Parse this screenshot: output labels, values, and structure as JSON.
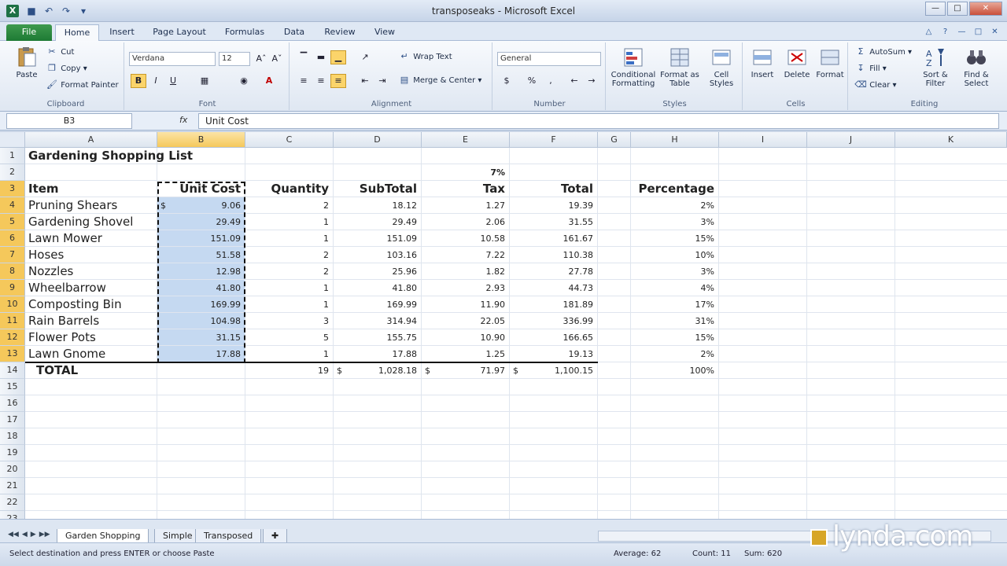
{
  "window": {
    "title": "transposeaks - Microsoft Excel"
  },
  "ribbon": {
    "tabs": [
      "File",
      "Home",
      "Insert",
      "Page Layout",
      "Formulas",
      "Data",
      "Review",
      "View"
    ],
    "active_tab": "Home",
    "clipboard": {
      "paste": "Paste",
      "cut": "Cut",
      "copy": "Copy",
      "format_painter": "Format Painter",
      "label": "Clipboard"
    },
    "font": {
      "name": "Verdana",
      "size": "12",
      "bold": "B",
      "italic": "I",
      "underline": "U",
      "label": "Font"
    },
    "alignment": {
      "wrap_text": "Wrap Text",
      "merge_center": "Merge & Center",
      "label": "Alignment"
    },
    "number": {
      "format": "General",
      "currency": "$",
      "percent": "%",
      "comma": ",",
      "label": "Number"
    },
    "styles": {
      "conditional": "Conditional Formatting",
      "format_table": "Format as Table",
      "cell_styles": "Cell Styles",
      "label": "Styles"
    },
    "cells": {
      "insert": "Insert",
      "delete": "Delete",
      "format": "Format",
      "label": "Cells"
    },
    "editing": {
      "autosum": "AutoSum",
      "fill": "Fill",
      "clear": "Clear",
      "sort_filter": "Sort & Filter",
      "find_select": "Find & Select",
      "label": "Editing"
    }
  },
  "formula_bar": {
    "name_box": "B3",
    "fx": "fx",
    "content": "Unit Cost"
  },
  "grid": {
    "columns": [
      "A",
      "B",
      "C",
      "D",
      "E",
      "F",
      "G",
      "H",
      "I",
      "J",
      "K"
    ],
    "selected_column": "B",
    "rows": [
      "1",
      "2",
      "3",
      "4",
      "5",
      "6",
      "7",
      "8",
      "9",
      "10",
      "11",
      "12",
      "13",
      "14",
      "15",
      "16",
      "17",
      "18",
      "19",
      "20",
      "21",
      "22",
      "23"
    ],
    "title": "Gardening Shopping List",
    "tax_rate": "7%",
    "headers": {
      "item": "Item",
      "unit_cost": "Unit Cost",
      "quantity": "Quantity",
      "subtotal": "SubTotal",
      "tax": "Tax",
      "total": "Total",
      "percentage": "Percentage"
    },
    "data": [
      {
        "item": "Pruning Shears",
        "unit_cost": "9.06",
        "quantity": "2",
        "subtotal": "18.12",
        "tax": "1.27",
        "total": "19.39",
        "pct": "2%"
      },
      {
        "item": "Gardening Shovel",
        "unit_cost": "29.49",
        "quantity": "1",
        "subtotal": "29.49",
        "tax": "2.06",
        "total": "31.55",
        "pct": "3%"
      },
      {
        "item": "Lawn Mower",
        "unit_cost": "151.09",
        "quantity": "1",
        "subtotal": "151.09",
        "tax": "10.58",
        "total": "161.67",
        "pct": "15%"
      },
      {
        "item": "Hoses",
        "unit_cost": "51.58",
        "quantity": "2",
        "subtotal": "103.16",
        "tax": "7.22",
        "total": "110.38",
        "pct": "10%"
      },
      {
        "item": "Nozzles",
        "unit_cost": "12.98",
        "quantity": "2",
        "subtotal": "25.96",
        "tax": "1.82",
        "total": "27.78",
        "pct": "3%"
      },
      {
        "item": "Wheelbarrow",
        "unit_cost": "41.80",
        "quantity": "1",
        "subtotal": "41.80",
        "tax": "2.93",
        "total": "44.73",
        "pct": "4%"
      },
      {
        "item": "Composting Bin",
        "unit_cost": "169.99",
        "quantity": "1",
        "subtotal": "169.99",
        "tax": "11.90",
        "total": "181.89",
        "pct": "17%"
      },
      {
        "item": "Rain Barrels",
        "unit_cost": "104.98",
        "quantity": "3",
        "subtotal": "314.94",
        "tax": "22.05",
        "total": "336.99",
        "pct": "31%"
      },
      {
        "item": "Flower Pots",
        "unit_cost": "31.15",
        "quantity": "5",
        "subtotal": "155.75",
        "tax": "10.90",
        "total": "166.65",
        "pct": "15%"
      },
      {
        "item": "Lawn Gnome",
        "unit_cost": "17.88",
        "quantity": "1",
        "subtotal": "17.88",
        "tax": "1.25",
        "total": "19.13",
        "pct": "2%"
      }
    ],
    "total_row": {
      "label": "TOTAL",
      "quantity": "19",
      "subtotal": "1,028.18",
      "tax": "71.97",
      "total": "1,100.15",
      "pct": "100%"
    },
    "currency_symbol": "$"
  },
  "sheets": {
    "tabs": [
      "Garden Shopping",
      "Simple",
      "Transposed"
    ],
    "active": "Garden Shopping"
  },
  "status": {
    "message": "Select destination and press ENTER or choose Paste",
    "average": "Average: 62",
    "count": "Count: 11",
    "sum": "Sum: 620"
  },
  "watermark": "lynda.com",
  "colors": {
    "selection": "#c5d9f1",
    "header_highlight": "#f5c85b",
    "file_tab": "#1d7a34"
  }
}
